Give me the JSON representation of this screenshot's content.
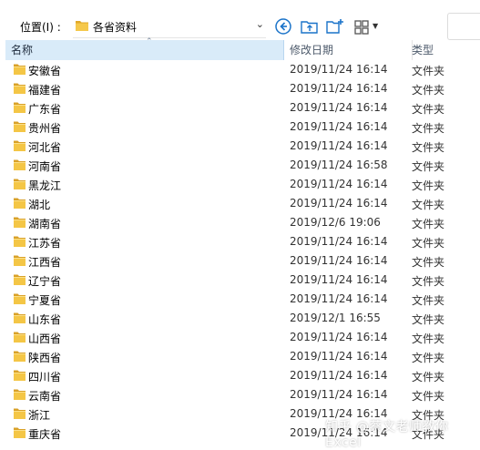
{
  "location": {
    "label": "位置(I) :",
    "path": "各省资料"
  },
  "columns": {
    "name": "名称",
    "date": "修改日期",
    "type": "类型"
  },
  "rows": [
    {
      "name": "安徽省",
      "date": "2019/11/24 16:14",
      "type": "文件夹"
    },
    {
      "name": "福建省",
      "date": "2019/11/24 16:14",
      "type": "文件夹"
    },
    {
      "name": "广东省",
      "date": "2019/11/24 16:14",
      "type": "文件夹"
    },
    {
      "name": "贵州省",
      "date": "2019/11/24 16:14",
      "type": "文件夹"
    },
    {
      "name": "河北省",
      "date": "2019/11/24 16:14",
      "type": "文件夹"
    },
    {
      "name": "河南省",
      "date": "2019/11/24 16:58",
      "type": "文件夹"
    },
    {
      "name": "黑龙江",
      "date": "2019/11/24 16:14",
      "type": "文件夹"
    },
    {
      "name": "湖北",
      "date": "2019/11/24 16:14",
      "type": "文件夹"
    },
    {
      "name": "湖南省",
      "date": "2019/12/6 19:06",
      "type": "文件夹"
    },
    {
      "name": "江苏省",
      "date": "2019/11/24 16:14",
      "type": "文件夹"
    },
    {
      "name": "江西省",
      "date": "2019/11/24 16:14",
      "type": "文件夹"
    },
    {
      "name": "辽宁省",
      "date": "2019/11/24 16:14",
      "type": "文件夹"
    },
    {
      "name": "宁夏省",
      "date": "2019/11/24 16:14",
      "type": "文件夹"
    },
    {
      "name": "山东省",
      "date": "2019/12/1 16:55",
      "type": "文件夹"
    },
    {
      "name": "山西省",
      "date": "2019/11/24 16:14",
      "type": "文件夹"
    },
    {
      "name": "陕西省",
      "date": "2019/11/24 16:14",
      "type": "文件夹"
    },
    {
      "name": "四川省",
      "date": "2019/11/24 16:14",
      "type": "文件夹"
    },
    {
      "name": "云南省",
      "date": "2019/11/24 16:14",
      "type": "文件夹"
    },
    {
      "name": "浙江",
      "date": "2019/11/24 16:14",
      "type": "文件夹"
    },
    {
      "name": "重庆省",
      "date": "2019/11/24 16:14",
      "type": "文件夹"
    }
  ],
  "watermark": "知乎 @蔡文老师教你Excel",
  "colors": {
    "folder": "#f2c443",
    "header_selected": "#d9ebf9",
    "accent": "#1a73c9"
  }
}
